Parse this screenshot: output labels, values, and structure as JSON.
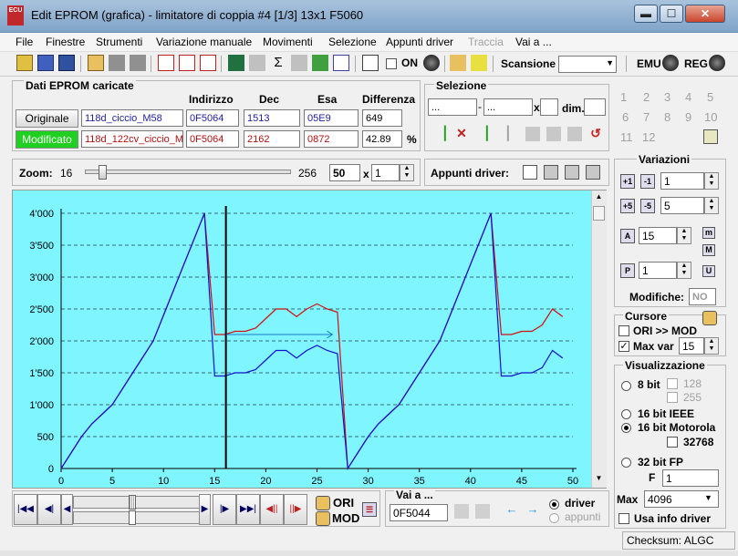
{
  "window": {
    "title": "Edit EPROM (grafica) - limitatore di coppia #4  [1/3]  13x1  F5060",
    "icon": "ECU"
  },
  "menu": [
    "File",
    "Finestre",
    "Strumenti",
    "Variazione manuale",
    "Movimenti",
    "Selezione",
    "Appunti driver",
    "Traccia",
    "Vai a ..."
  ],
  "toolbar": {
    "on_label": "ON",
    "scan_label": "Scansione",
    "emu_label": "EMU",
    "reg_label": "REG"
  },
  "eprom": {
    "title": "Dati EPROM caricate",
    "headers": [
      "Indirizzo",
      "Dec",
      "Esa",
      "Differenza"
    ],
    "rows": [
      {
        "label": "Originale",
        "name": "118d_ciccio_M58",
        "addr": "0F5064",
        "dec": "1513",
        "hex": "05E9",
        "diff": "649",
        "diff_unit": ""
      },
      {
        "label": "Modificato",
        "name": "118d_122cv_ciccio_M",
        "addr": "0F5064",
        "dec": "2162",
        "hex": "0872",
        "diff": "42.89",
        "diff_unit": "%"
      }
    ]
  },
  "selezione": {
    "title": "Selezione",
    "from": "...",
    "to": "...",
    "x_label": "x",
    "dim_label": "dim."
  },
  "numpad": [
    "1",
    "2",
    "3",
    "4",
    "5",
    "6",
    "7",
    "8",
    "9",
    "10",
    "11",
    "12"
  ],
  "zoom": {
    "label": "Zoom:",
    "min": "16",
    "max": "256",
    "value": "50",
    "x_label": "x",
    "factor": "1",
    "slider_level": 0.07
  },
  "appunti": {
    "label": "Appunti driver:"
  },
  "variazioni": {
    "title": "Variazioni",
    "v1": "1",
    "v2": "5",
    "v3": "15",
    "v4": "1",
    "modifiche_label": "Modifiche:",
    "modifiche_value": "NO"
  },
  "cursore": {
    "title": "Cursore",
    "ori_mod": "ORI >> MOD",
    "maxvar_label": "Max var",
    "maxvar_value": "15"
  },
  "visualizzazione": {
    "title": "Visualizzazione",
    "opt_8bit": "8 bit",
    "v128": "128",
    "v255": "255",
    "opt_16ieee": "16 bit IEEE",
    "opt_16moto": "16 bit Motorola",
    "v32768": "32768",
    "opt_32fp": "32 bit FP",
    "f_label": "F",
    "f_value": "1",
    "max_label": "Max",
    "max_value": "4096",
    "usa_info": "Usa info driver"
  },
  "bottom": {
    "ori_label": "ORI",
    "mod_label": "MOD",
    "vai_label": "Vai a ...",
    "vai_value": "0F5044",
    "driver_label": "driver",
    "appunti_label": "appunti"
  },
  "status": {
    "checksum": "Checksum: ALGC"
  },
  "chart_data": {
    "type": "line",
    "xlim": [
      0,
      50
    ],
    "ylim": [
      0,
      4000
    ],
    "xticks": [
      "0",
      "5",
      "10",
      "15",
      "20",
      "25",
      "30",
      "35",
      "40",
      "45",
      "50"
    ],
    "yticks": [
      "0",
      "500",
      "1'000",
      "1'500",
      "2'000",
      "2'500",
      "3'000",
      "3'500",
      "4'000"
    ],
    "cursor_x": 16.1,
    "series": [
      {
        "color": "#d01010",
        "x": [
          0,
          1,
          2,
          3,
          4,
          5,
          6,
          7,
          8,
          9,
          10,
          11,
          12,
          13,
          14,
          15,
          16,
          17,
          18,
          19,
          20,
          21,
          22,
          23,
          24,
          25,
          26,
          27,
          28,
          29,
          30,
          31,
          32,
          33,
          34,
          35,
          36,
          37,
          38,
          39,
          40,
          41,
          42,
          43,
          44,
          45,
          46,
          47,
          48,
          49
        ],
        "y": [
          0,
          250,
          500,
          700,
          850,
          1000,
          1250,
          1500,
          1750,
          2000,
          2400,
          2800,
          3200,
          3600,
          4000,
          2100,
          2100,
          2150,
          2150,
          2200,
          2350,
          2500,
          2500,
          2380,
          2500,
          2580,
          2500,
          2450,
          0,
          250,
          500,
          700,
          850,
          1000,
          1250,
          1500,
          1750,
          2000,
          2400,
          2800,
          3200,
          3600,
          4000,
          2100,
          2100,
          2150,
          2150,
          2250,
          2500,
          2380
        ]
      },
      {
        "color": "#1010d0",
        "x": [
          0,
          1,
          2,
          3,
          4,
          5,
          6,
          7,
          8,
          9,
          10,
          11,
          12,
          13,
          14,
          15,
          16,
          17,
          18,
          19,
          20,
          21,
          22,
          23,
          24,
          25,
          26,
          27,
          28,
          29,
          30,
          31,
          32,
          33,
          34,
          35,
          36,
          37,
          38,
          39,
          40,
          41,
          42,
          43,
          44,
          45,
          46,
          47,
          48,
          49
        ],
        "y": [
          0,
          250,
          500,
          700,
          850,
          1000,
          1250,
          1500,
          1750,
          2000,
          2400,
          2800,
          3200,
          3600,
          4000,
          1450,
          1450,
          1500,
          1500,
          1550,
          1700,
          1850,
          1850,
          1730,
          1850,
          1930,
          1850,
          1800,
          0,
          250,
          500,
          700,
          850,
          1000,
          1250,
          1500,
          1750,
          2000,
          2400,
          2800,
          3200,
          3600,
          4000,
          1450,
          1450,
          1500,
          1500,
          1580,
          1850,
          1730
        ]
      }
    ]
  }
}
